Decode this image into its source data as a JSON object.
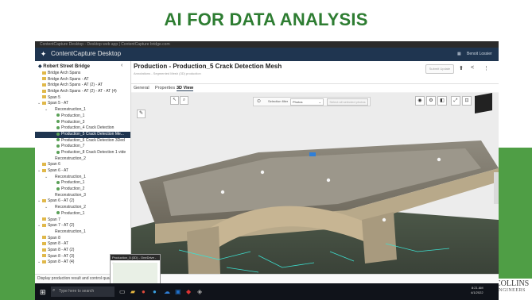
{
  "slide": {
    "title": "AI FOR DATA ANALYSIS",
    "logo_text": "COLLINS",
    "logo_sub": "ENGINEERS"
  },
  "browser": {
    "url_text": "ContentCapture Desktop - Desktop web app | ContentCapture bridge.com"
  },
  "app": {
    "title": "ContentCapture Desktop",
    "user": "Benoit Lossier"
  },
  "sidebar": {
    "header": "Robert Street Bridge",
    "items": [
      {
        "label": "Bridge Arch Spans",
        "depth": 0,
        "type": "folder",
        "chev": ""
      },
      {
        "label": "Bridge Arch Spans - AT",
        "depth": 0,
        "type": "folder",
        "chev": ""
      },
      {
        "label": "Bridge Arch Spans - AT (2) - AT",
        "depth": 0,
        "type": "folder",
        "chev": ""
      },
      {
        "label": "Bridge Arch Spans - AT (2) - AT - AT (4)",
        "depth": 0,
        "type": "folder",
        "chev": ""
      },
      {
        "label": "Span 5",
        "depth": 0,
        "type": "folder",
        "chev": ""
      },
      {
        "label": "Span 5 - AT",
        "depth": 0,
        "type": "folder",
        "chev": "v"
      },
      {
        "label": "Reconstruction_1",
        "depth": 1,
        "type": "none",
        "chev": "v"
      },
      {
        "label": "Production_1",
        "depth": 2,
        "type": "dot",
        "chev": ""
      },
      {
        "label": "Production_3",
        "depth": 2,
        "type": "dot",
        "chev": ""
      },
      {
        "label": "Production_4 Crack Detection",
        "depth": 2,
        "type": "dot",
        "chev": ""
      },
      {
        "label": "Production_5 Crack Detection Me...",
        "depth": 2,
        "type": "dot",
        "chev": "",
        "selected": true
      },
      {
        "label": "Production_6 Crack Detection 3Ded",
        "depth": 2,
        "type": "dot",
        "chev": ""
      },
      {
        "label": "Production_7",
        "depth": 2,
        "type": "dot",
        "chev": ""
      },
      {
        "label": "Production_8 Crack Detection 1 vide",
        "depth": 2,
        "type": "dot",
        "chev": ""
      },
      {
        "label": "Reconstruction_2",
        "depth": 1,
        "type": "none",
        "chev": ""
      },
      {
        "label": "Span 6",
        "depth": 0,
        "type": "folder",
        "chev": ""
      },
      {
        "label": "Span 6 - AT",
        "depth": 0,
        "type": "folder",
        "chev": "v"
      },
      {
        "label": "Reconstruction_1",
        "depth": 1,
        "type": "none",
        "chev": "v"
      },
      {
        "label": "Production_1",
        "depth": 2,
        "type": "dot",
        "chev": ""
      },
      {
        "label": "Production_2",
        "depth": 2,
        "type": "dot",
        "chev": ""
      },
      {
        "label": "Reconstruction_3",
        "depth": 1,
        "type": "none",
        "chev": ""
      },
      {
        "label": "Span 6 - AT (2)",
        "depth": 0,
        "type": "folder",
        "chev": "v"
      },
      {
        "label": "Reconstruction_2",
        "depth": 1,
        "type": "none",
        "chev": "v"
      },
      {
        "label": "Production_1",
        "depth": 2,
        "type": "dot",
        "chev": ""
      },
      {
        "label": "Span 7",
        "depth": 0,
        "type": "folder",
        "chev": ""
      },
      {
        "label": "Span 7 - AT (2)",
        "depth": 0,
        "type": "folder",
        "chev": "v"
      },
      {
        "label": "Reconstruction_1",
        "depth": 1,
        "type": "none",
        "chev": ""
      },
      {
        "label": "Span 8",
        "depth": 0,
        "type": "folder",
        "chev": ""
      },
      {
        "label": "Span 8 - AT",
        "depth": 0,
        "type": "folder",
        "chev": ""
      },
      {
        "label": "Span 8 - AT (2)",
        "depth": 0,
        "type": "folder",
        "chev": ""
      },
      {
        "label": "Span 8 - AT (3)",
        "depth": 0,
        "type": "folder",
        "chev": ""
      },
      {
        "label": "Span 8 - AT (4)",
        "depth": 0,
        "type": "folder",
        "chev": "v"
      }
    ]
  },
  "main": {
    "title": "Production - Production_5 Crack Detection Mesh",
    "subtitle": "Annotations - Segmented Mesh (3D) production",
    "submit_label": "Submit Update",
    "tabs": [
      {
        "label": "General"
      },
      {
        "label": "Properties"
      },
      {
        "label": "3D View",
        "active": true
      }
    ]
  },
  "viewer": {
    "selection_label": "Selection filter",
    "selection_value": "Photos",
    "action_label": "Select all selected photos"
  },
  "status": {
    "text": "Display production result and control quality"
  },
  "thumbnail": {
    "title": "Production_5 (3D) - OneDrive - Co..."
  },
  "taskbar": {
    "search_placeholder": "Type here to search",
    "time": "8:21 AM",
    "date": "4/1/2022"
  }
}
